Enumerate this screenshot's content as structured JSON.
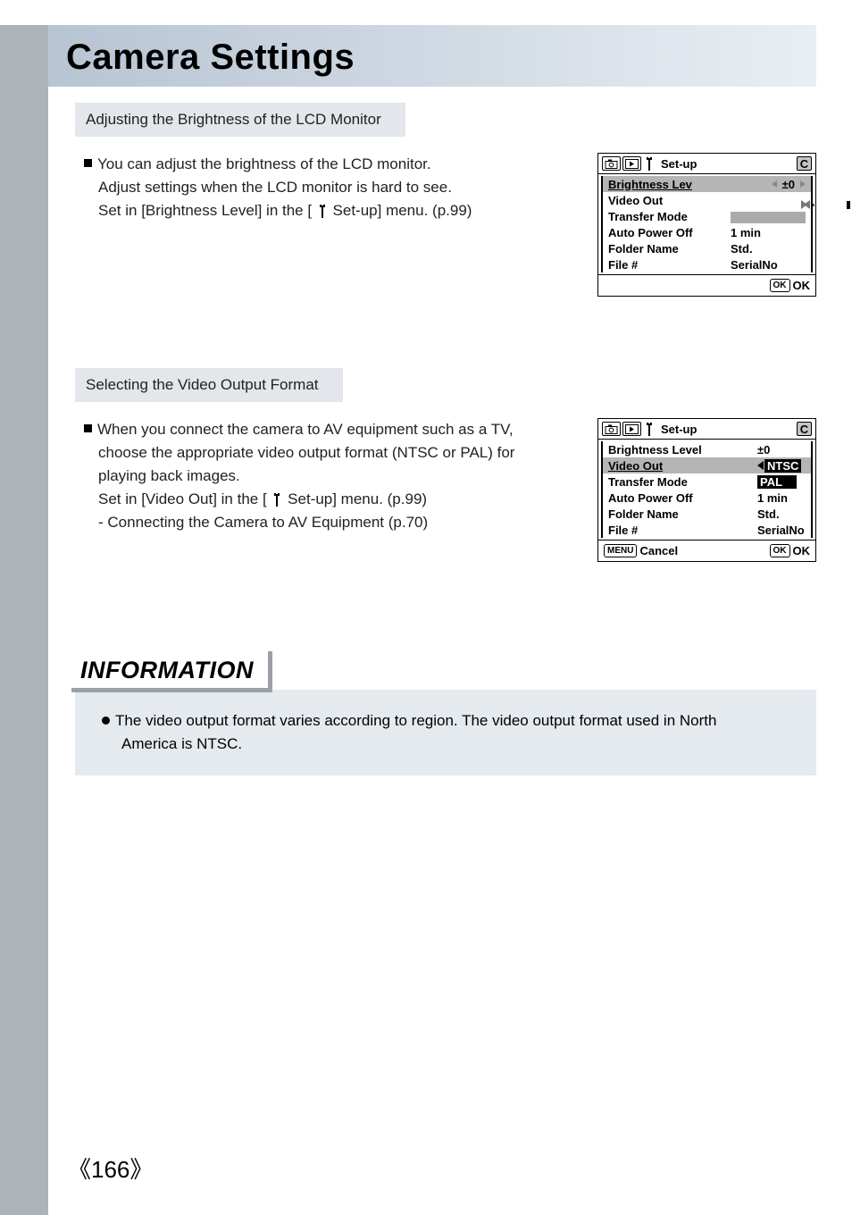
{
  "title": "Camera Settings",
  "section1": {
    "subhead": "Adjusting the Brightness of the LCD Monitor",
    "line1": "You can adjust the brightness of the LCD monitor.",
    "line2": "Adjust settings when the LCD monitor is hard to see.",
    "line3a": "Set in [Brightness Level] in the [ ",
    "line3b": " Set-up] menu. (p.99)"
  },
  "lcd1": {
    "title": "Set-up",
    "c": "C",
    "rows": {
      "r1": {
        "label": "Brightness Lev",
        "value": "±0"
      },
      "r2": {
        "label": "Video Out"
      },
      "r3": {
        "label": "Transfer Mode"
      },
      "r4": {
        "label": "Auto Power Off",
        "value": "1 min"
      },
      "r5": {
        "label": "Folder Name",
        "value": "Std."
      },
      "r6": {
        "label": "File #",
        "value": "SerialNo"
      }
    },
    "footer": {
      "ok_btn": "OK",
      "ok_lbl": "OK"
    }
  },
  "section2": {
    "subhead": "Selecting the Video Output Format",
    "line1": "When you connect the camera to AV equipment such as a TV,",
    "line2": "choose the appropriate video output format (NTSC or PAL) for",
    "line3": "playing back images.",
    "line4a": "Set in [Video Out] in the [ ",
    "line4b": " Set-up] menu. (p.99)",
    "line5": "- Connecting the Camera to AV Equipment (p.70)"
  },
  "lcd2": {
    "title": "Set-up",
    "c": "C",
    "rows": {
      "r1": {
        "label": "Brightness Level",
        "value": "±0"
      },
      "r2": {
        "label": "Video Out",
        "value": "NTSC"
      },
      "r3": {
        "label": "Transfer Mode",
        "value": "PAL"
      },
      "r4": {
        "label": "Auto Power Off",
        "value": "1 min"
      },
      "r5": {
        "label": "Folder Name",
        "value": "Std."
      },
      "r6": {
        "label": "File #",
        "value": "SerialNo"
      }
    },
    "footer": {
      "menu_btn": "MENU",
      "cancel_lbl": "Cancel",
      "ok_btn": "OK",
      "ok_lbl": "OK"
    }
  },
  "info": {
    "heading": "INFORMATION",
    "line1": "The video output format varies according to region. The video output format used in North",
    "line2": "America is NTSC."
  },
  "page_number": "166"
}
